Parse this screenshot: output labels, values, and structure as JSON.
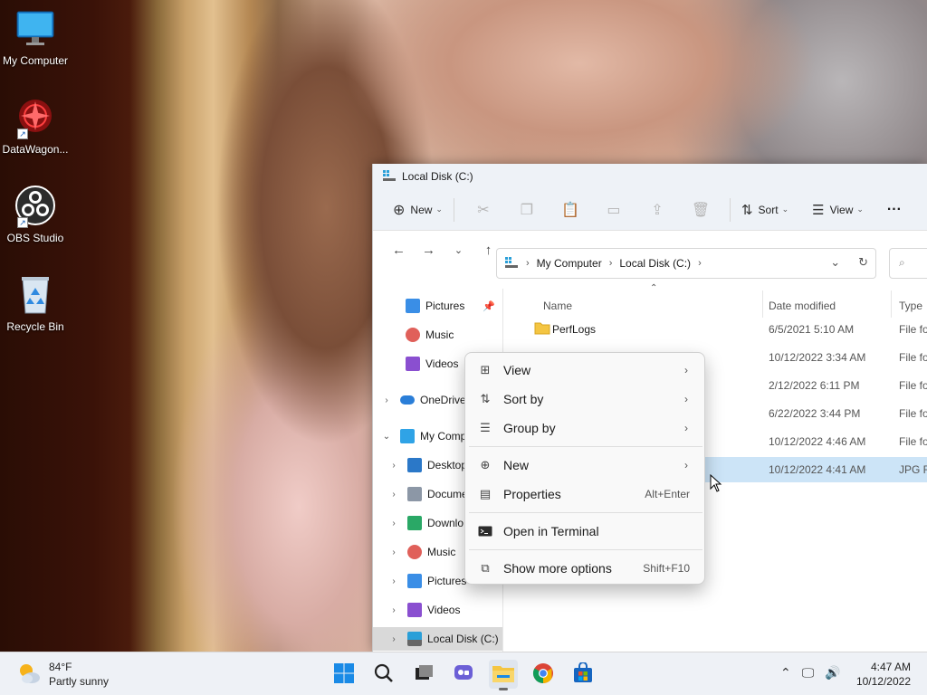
{
  "desktop": {
    "icons": [
      {
        "label": "My Computer",
        "icon": "monitor-icon"
      },
      {
        "label": "DataWagon...",
        "icon": "datawagon-icon"
      },
      {
        "label": "OBS Studio",
        "icon": "obs-icon"
      },
      {
        "label": "Recycle Bin",
        "icon": "recycle-bin-icon"
      }
    ]
  },
  "window": {
    "title": "Local Disk (C:)",
    "toolbar": {
      "new_label": "New",
      "sort_label": "Sort",
      "view_label": "View",
      "more_label": "···"
    },
    "address": {
      "crumbs": [
        "My Computer",
        "Local Disk (C:)"
      ]
    },
    "nav": {
      "items": [
        {
          "label": "Pictures",
          "icon": "pictures-icon"
        },
        {
          "label": "Music",
          "icon": "music-icon"
        },
        {
          "label": "Videos",
          "icon": "videos-icon"
        },
        {
          "label": "OneDrive",
          "icon": "onedrive-icon"
        },
        {
          "label": "My Comp",
          "icon": "computer-icon"
        },
        {
          "label": "Desktop",
          "icon": "desktop-folder-icon"
        },
        {
          "label": "Docume",
          "icon": "documents-icon"
        },
        {
          "label": "Downlo",
          "icon": "downloads-icon"
        },
        {
          "label": "Music",
          "icon": "music-icon"
        },
        {
          "label": "Pictures",
          "icon": "pictures-icon"
        },
        {
          "label": "Videos",
          "icon": "videos-icon"
        },
        {
          "label": "Local Disk (C:)",
          "icon": "drive-icon"
        }
      ]
    },
    "columns": {
      "name": "Name",
      "date": "Date modified",
      "type": "Type"
    },
    "files": [
      {
        "name": "PerfLogs",
        "date": "6/5/2021 5:10 AM",
        "type": "File fo"
      },
      {
        "name": "",
        "date": "10/12/2022 3:34 AM",
        "type": "File fo"
      },
      {
        "name": "",
        "date": "2/12/2022 6:11 PM",
        "type": "File fo"
      },
      {
        "name": "",
        "date": "6/22/2022 3:44 PM",
        "type": "File fo"
      },
      {
        "name": "",
        "date": "10/12/2022 4:46 AM",
        "type": "File fo"
      },
      {
        "name": "",
        "date": "10/12/2022 4:41 AM",
        "type": "JPG Fi"
      }
    ]
  },
  "context_menu": {
    "view": "View",
    "sort_by": "Sort by",
    "group_by": "Group by",
    "new": "New",
    "properties": "Properties",
    "properties_shortcut": "Alt+Enter",
    "open_terminal": "Open in Terminal",
    "show_more": "Show more options",
    "show_more_shortcut": "Shift+F10"
  },
  "taskbar": {
    "weather_temp": "84°F",
    "weather_desc": "Partly sunny",
    "time": "4:47 AM",
    "date": "10/12/2022",
    "apps": [
      "start-icon",
      "search-icon",
      "task-view-icon",
      "chat-icon",
      "file-explorer-icon",
      "chrome-icon",
      "store-icon"
    ]
  },
  "colors": {
    "accent": "#0067c0",
    "selection": "#cce4f7",
    "folder": "#f4c542"
  }
}
